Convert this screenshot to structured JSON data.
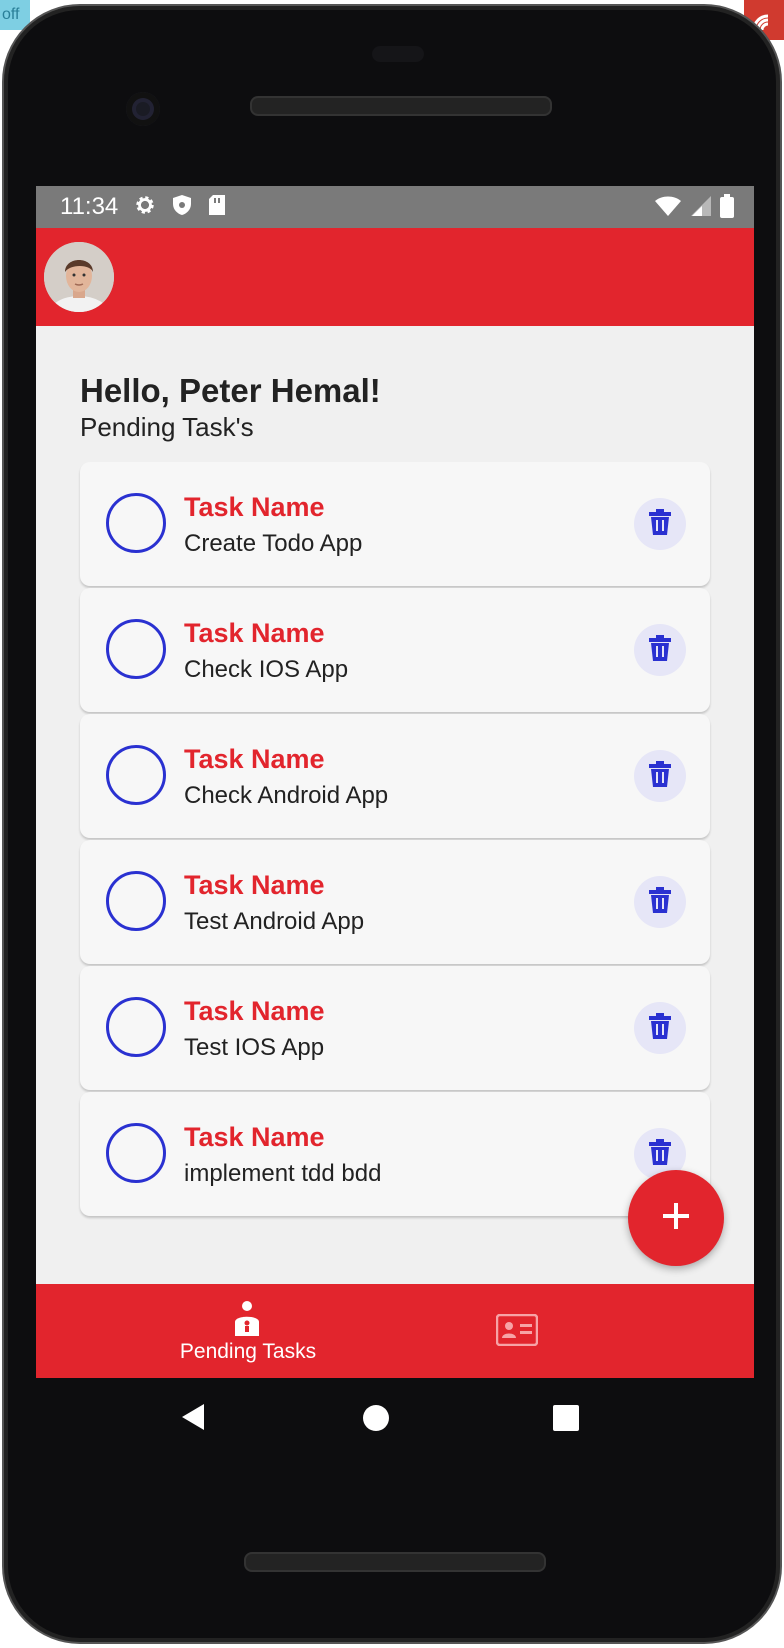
{
  "external": {
    "corner_label": "off"
  },
  "status_bar": {
    "time": "11:34"
  },
  "colors": {
    "accent": "#e2252d",
    "checkbox": "#2a31d1",
    "delete_bg": "#e6e6f7",
    "screen_bg": "#f0f0f0"
  },
  "header": {
    "avatar": "user-avatar"
  },
  "main": {
    "greeting": "Hello, Peter Hemal!",
    "subtitle": "Pending Task's",
    "tasks": [
      {
        "title": "Task Name",
        "description": "Create Todo App"
      },
      {
        "title": "Task Name",
        "description": "Check IOS App"
      },
      {
        "title": "Task Name",
        "description": "Check Android App"
      },
      {
        "title": "Task Name",
        "description": "Test Android App"
      },
      {
        "title": "Task Name",
        "description": "Test IOS App"
      },
      {
        "title": "Task Name",
        "description": "implement tdd bdd"
      }
    ]
  },
  "fab": {
    "icon": "plus-icon"
  },
  "bottom_nav": {
    "items": [
      {
        "label": "Pending Tasks",
        "icon": "person-icon",
        "active": true
      },
      {
        "label": "",
        "icon": "id-card-icon",
        "active": false
      }
    ]
  },
  "system_nav": {
    "buttons": [
      "back-icon",
      "home-icon",
      "recents-icon"
    ]
  }
}
